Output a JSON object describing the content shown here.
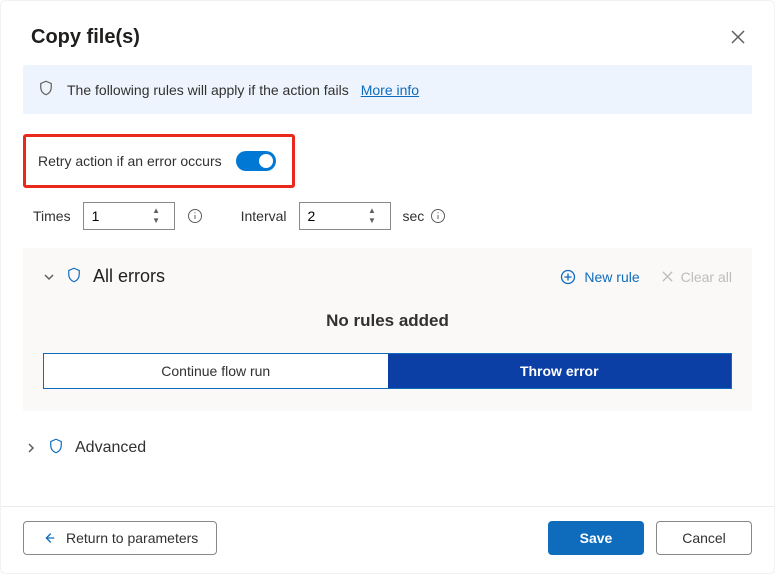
{
  "header": {
    "title": "Copy file(s)"
  },
  "banner": {
    "text": "The following rules will apply if the action fails ",
    "link_text": "More info"
  },
  "retry": {
    "label": "Retry action if an error occurs",
    "enabled": true
  },
  "times": {
    "label": "Times",
    "value": "1"
  },
  "interval": {
    "label": "Interval",
    "value": "2",
    "suffix": "sec"
  },
  "errors": {
    "title": "All errors",
    "new_rule_label": "New rule",
    "clear_all_label": "Clear all",
    "empty_text": "No rules added",
    "continue_label": "Continue flow run",
    "throw_label": "Throw error"
  },
  "advanced": {
    "title": "Advanced"
  },
  "footer": {
    "return_label": "Return to parameters",
    "save_label": "Save",
    "cancel_label": "Cancel"
  }
}
